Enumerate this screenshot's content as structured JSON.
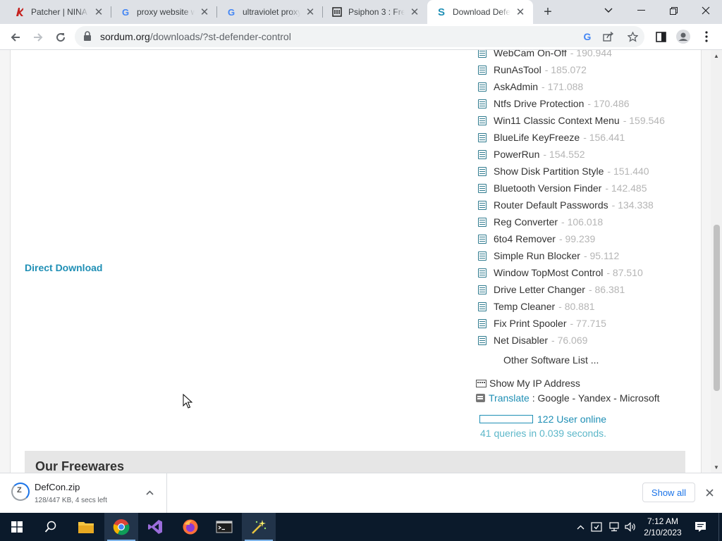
{
  "tabs": [
    {
      "title": "Patcher | NINA",
      "icon": "nina-icon"
    },
    {
      "title": "proxy website w",
      "icon": "google-icon"
    },
    {
      "title": "ultraviolet proxy",
      "icon": "google-icon"
    },
    {
      "title": "Psiphon 3 : Free",
      "icon": "psiphon-icon"
    },
    {
      "title": "Download Defe",
      "icon": "sordum-icon",
      "active": true
    }
  ],
  "address": {
    "host": "sordum.org",
    "path": "/downloads/?st-defender-control"
  },
  "page": {
    "direct_download": "Direct Download",
    "software": [
      {
        "name": "WebCam On-Off",
        "count": "- 190.944"
      },
      {
        "name": "RunAsTool",
        "count": "- 185.072"
      },
      {
        "name": "AskAdmin",
        "count": "- 171.088"
      },
      {
        "name": "Ntfs Drive Protection",
        "count": "- 170.486"
      },
      {
        "name": "Win11 Classic Context Menu",
        "count": "- 159.546"
      },
      {
        "name": "BlueLife KeyFreeze",
        "count": "- 156.441"
      },
      {
        "name": "PowerRun",
        "count": "- 154.552"
      },
      {
        "name": "Show Disk Partition Style",
        "count": "- 151.440"
      },
      {
        "name": "Bluetooth Version Finder",
        "count": "- 142.485"
      },
      {
        "name": "Router Default Passwords",
        "count": "- 134.338"
      },
      {
        "name": "Reg Converter",
        "count": "- 106.018"
      },
      {
        "name": "6to4 Remover",
        "count": "- 99.239"
      },
      {
        "name": "Simple Run Blocker",
        "count": "- 95.112"
      },
      {
        "name": "Window TopMost Control",
        "count": "- 87.510"
      },
      {
        "name": "Drive Letter Changer",
        "count": "- 86.381"
      },
      {
        "name": "Temp Cleaner",
        "count": "- 80.881"
      },
      {
        "name": "Fix Print Spooler",
        "count": "- 77.715"
      },
      {
        "name": "Net Disabler",
        "count": "- 76.069"
      }
    ],
    "other_software": "Other Software List ...",
    "show_ip": "Show My IP Address",
    "translate": {
      "label": "Translate",
      "sep": " : ",
      "providers": "Google - Yandex - Microsoft"
    },
    "online": "122 User online",
    "queries": "41 queries in 0.039 seconds.",
    "section_title": "Our Freewares"
  },
  "download": {
    "file": "DefCon.zip",
    "status": "128/447 KB, 4 secs left",
    "show_all": "Show all"
  },
  "clock": {
    "time": "7:12 AM",
    "date": "2/10/2023"
  },
  "colors": {
    "accent": "#1f8fb5",
    "count_gray": "#b5b5b5",
    "taskbar": "#0b1a2b"
  }
}
